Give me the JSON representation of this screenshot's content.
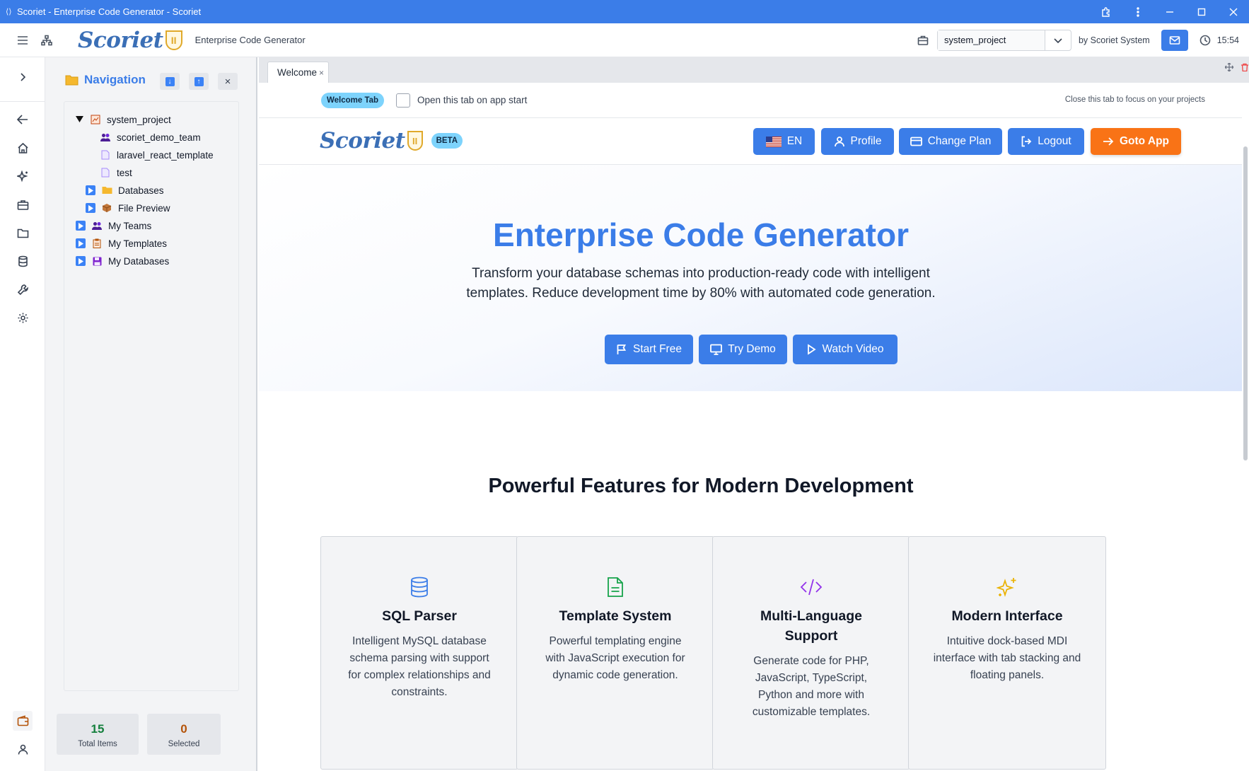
{
  "window": {
    "title": "Scoriet - Enterprise Code Generator - Scoriet"
  },
  "header": {
    "logo_text": "Scoriet",
    "logo_mark": "II",
    "subtitle": "Enterprise Code Generator",
    "project_value": "system_project",
    "by_text": "by Scoriet System",
    "time": "15:54"
  },
  "navigation": {
    "title": "Navigation",
    "tree": [
      {
        "label": "system_project",
        "icon": "project-icon",
        "expander": "expanded"
      },
      {
        "label": "scoriet_demo_team",
        "icon": "team-icon",
        "expander": "none"
      },
      {
        "label": "laravel_react_template",
        "icon": "template-file-icon",
        "expander": "none"
      },
      {
        "label": "test",
        "icon": "template-file-icon",
        "expander": "none"
      },
      {
        "label": "Databases",
        "icon": "folder-icon",
        "expander": "collapsed"
      },
      {
        "label": "File Preview",
        "icon": "package-icon",
        "expander": "collapsed"
      },
      {
        "label": "My Teams",
        "icon": "team-icon",
        "expander": "collapsed"
      },
      {
        "label": "My Templates",
        "icon": "clipboard-icon",
        "expander": "collapsed"
      },
      {
        "label": "My Databases",
        "icon": "floppy-disk-icon",
        "expander": "collapsed"
      }
    ],
    "stats": {
      "total_value": "15",
      "total_label": "Total Items",
      "selected_value": "0",
      "selected_label": "Selected"
    }
  },
  "tabs": {
    "active": "Welcome",
    "close_glyph": "×"
  },
  "welcome_bar": {
    "badge": "Welcome Tab",
    "checkbox_label": "Open this tab on app start",
    "checkbox_checked": false,
    "close_hint": "Close this tab to focus on your projects"
  },
  "inner_header": {
    "beta": "BETA",
    "lang": "EN",
    "profile": "Profile",
    "change_plan": "Change Plan",
    "logout": "Logout",
    "goto_app": "Goto App"
  },
  "hero": {
    "title": "Enterprise Code Generator",
    "subtitle": "Transform your database schemas into production-ready code with intelligent templates. Reduce development time by 80% with automated code generation.",
    "start_free": "Start Free",
    "try_demo": "Try Demo",
    "watch_video": "Watch Video"
  },
  "features": {
    "title": "Powerful Features for Modern Development",
    "cards": [
      {
        "title": "SQL Parser",
        "desc": "Intelligent MySQL database schema parsing with support for complex relationships and constraints.",
        "icon": "database-icon",
        "color": "#3b7de8"
      },
      {
        "title": "Template System",
        "desc": "Powerful templating engine with JavaScript execution for dynamic code generation.",
        "icon": "file-text-icon",
        "color": "#16a34a"
      },
      {
        "title": "Multi-Language Support",
        "desc": "Generate code for PHP, JavaScript, TypeScript, Python and more with customizable templates.",
        "icon": "code-icon",
        "color": "#9333ea"
      },
      {
        "title": "Modern Interface",
        "desc": "Intuitive dock-based MDI interface with tab stacking and floating panels.",
        "icon": "sparkles-icon",
        "color": "#eab308"
      }
    ]
  },
  "colors": {
    "accent": "#3b7de8",
    "orange": "#f97316",
    "badge": "#7dd3fc",
    "total_green": "#15803d",
    "selected_amber": "#b45309"
  }
}
